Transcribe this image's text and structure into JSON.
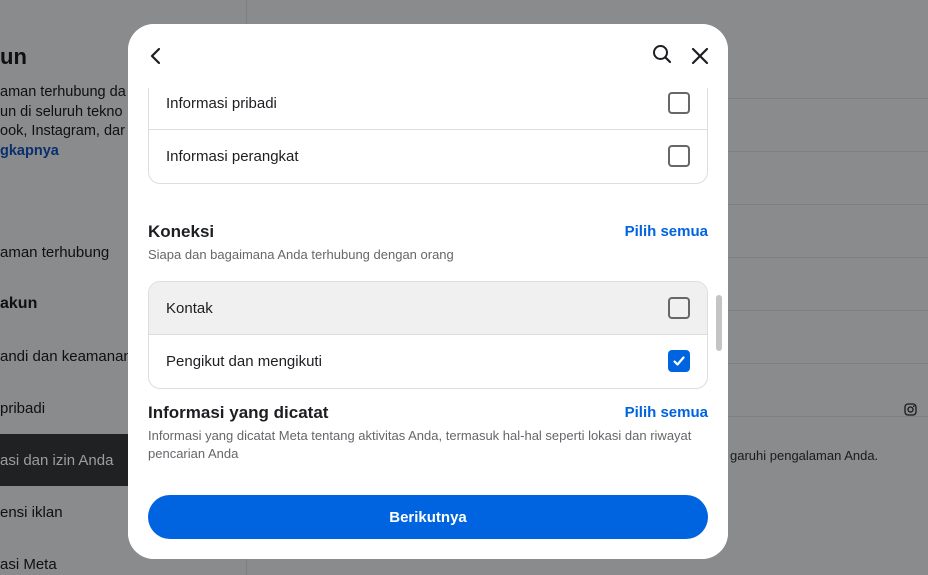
{
  "background": {
    "title": "un",
    "desc_lines": [
      "aman terhubung da",
      "un di seluruh tekno",
      "ook, Instagram, dar"
    ],
    "learn_more": "gkapnya",
    "nav": [
      {
        "label": "aman terhubung"
      },
      {
        "label": "akun"
      },
      {
        "label": "andi dan keamanan"
      },
      {
        "label": "pribadi"
      },
      {
        "label": "asi dan izin Anda"
      },
      {
        "label": "ensi iklan"
      },
      {
        "label": "asi Meta"
      }
    ],
    "right_text": "garuhi pengalaman Anda."
  },
  "modal": {
    "top_items": [
      {
        "label": "Informasi pribadi",
        "checked": false
      },
      {
        "label": "Informasi perangkat",
        "checked": false
      }
    ],
    "sections": [
      {
        "title": "Koneksi",
        "select_all": "Pilih semua",
        "description": "Siapa dan bagaimana Anda terhubung dengan orang",
        "items": [
          {
            "label": "Kontak",
            "checked": false
          },
          {
            "label": "Pengikut dan mengikuti",
            "checked": true
          }
        ]
      },
      {
        "title": "Informasi yang dicatat",
        "select_all": "Pilih semua",
        "description": "Informasi yang dicatat Meta tentang aktivitas Anda, termasuk hal-hal seperti lokasi dan riwayat pencarian Anda"
      }
    ],
    "next_button": "Berikutnya"
  },
  "icons": {
    "back": "chevron-left-icon",
    "search": "search-icon",
    "close": "close-icon",
    "check": "checkmark-icon",
    "instagram": "instagram-icon"
  },
  "colors": {
    "accent": "#0064e0",
    "overlay": "#8a8b8c",
    "text": "#1c1e21",
    "secondary_text": "#65676b"
  }
}
